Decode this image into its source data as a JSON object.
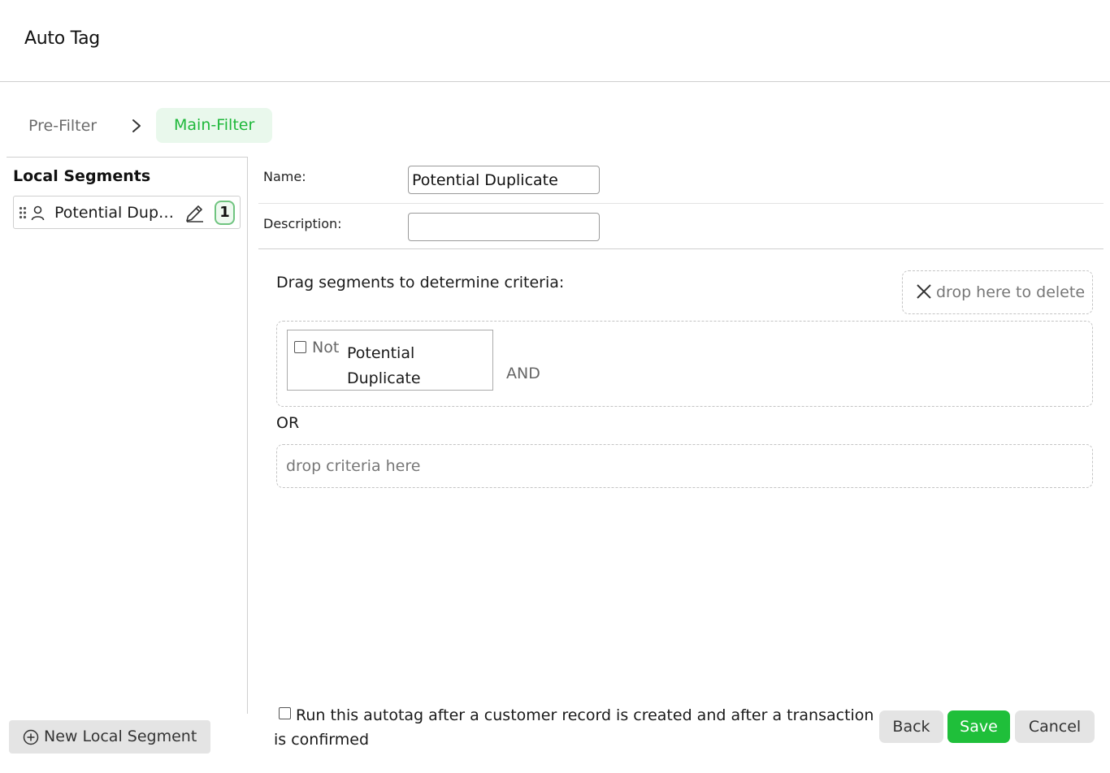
{
  "header": {
    "title": "Auto Tag"
  },
  "breadcrumb": {
    "steps": [
      {
        "label": "Pre-Filter",
        "active": false
      },
      {
        "label": "Main-Filter",
        "active": true
      }
    ]
  },
  "sidebar": {
    "title": "Local Segments",
    "segments": [
      {
        "label": "Potential Duplicate",
        "count": "1",
        "icon": "user-icon"
      }
    ],
    "new_button_label": "New Local Segment"
  },
  "form": {
    "name_label": "Name:",
    "name_value": "Potential Duplicate",
    "description_label": "Description:",
    "description_value": ""
  },
  "criteria": {
    "heading": "Drag segments to determine criteria:",
    "delete_zone_label": "drop here to delete",
    "groups": [
      {
        "items": [
          {
            "not_label": "Not",
            "not_checked": false,
            "segment_label": "Potential Duplicate"
          }
        ],
        "and_label": "AND"
      }
    ],
    "or_label": "OR",
    "drop_zone_label": "drop criteria here"
  },
  "footer": {
    "run_option_label": "Run this autotag after a customer record is created and after a transaction is confirmed",
    "run_option_checked": false,
    "back_label": "Back",
    "save_label": "Save",
    "cancel_label": "Cancel"
  },
  "colors": {
    "accent": "#1fbf3a",
    "accent_bg": "#e9f8ec",
    "neutral_button": "#e4e4e4"
  }
}
